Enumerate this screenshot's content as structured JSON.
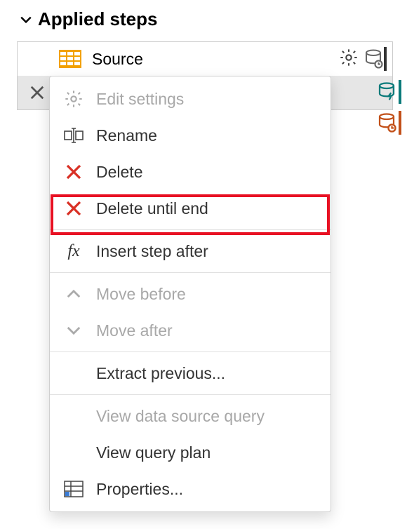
{
  "header": {
    "title": "Applied steps"
  },
  "steps": [
    {
      "label": "Source"
    }
  ],
  "context_menu": {
    "items": [
      {
        "key": "edit_settings",
        "label": "Edit settings",
        "disabled": true,
        "icon": "gear"
      },
      {
        "key": "rename",
        "label": "Rename",
        "disabled": false,
        "icon": "rename"
      },
      {
        "key": "delete",
        "label": "Delete",
        "disabled": false,
        "icon": "x-red"
      },
      {
        "key": "delete_until_end",
        "label": "Delete until end",
        "disabled": false,
        "icon": "x-red",
        "highlighted": true
      },
      {
        "key": "insert_step_after",
        "label": "Insert step after",
        "disabled": false,
        "icon": "fx"
      },
      {
        "key": "move_before",
        "label": "Move before",
        "disabled": true,
        "icon": "chev-up"
      },
      {
        "key": "move_after",
        "label": "Move after",
        "disabled": true,
        "icon": "chev-down"
      },
      {
        "key": "extract_previous",
        "label": "Extract previous...",
        "disabled": false,
        "icon": ""
      },
      {
        "key": "view_data_source_query",
        "label": "View data source query",
        "disabled": true,
        "icon": ""
      },
      {
        "key": "view_query_plan",
        "label": "View query plan",
        "disabled": false,
        "icon": ""
      },
      {
        "key": "properties",
        "label": "Properties...",
        "disabled": false,
        "icon": "table"
      }
    ]
  }
}
